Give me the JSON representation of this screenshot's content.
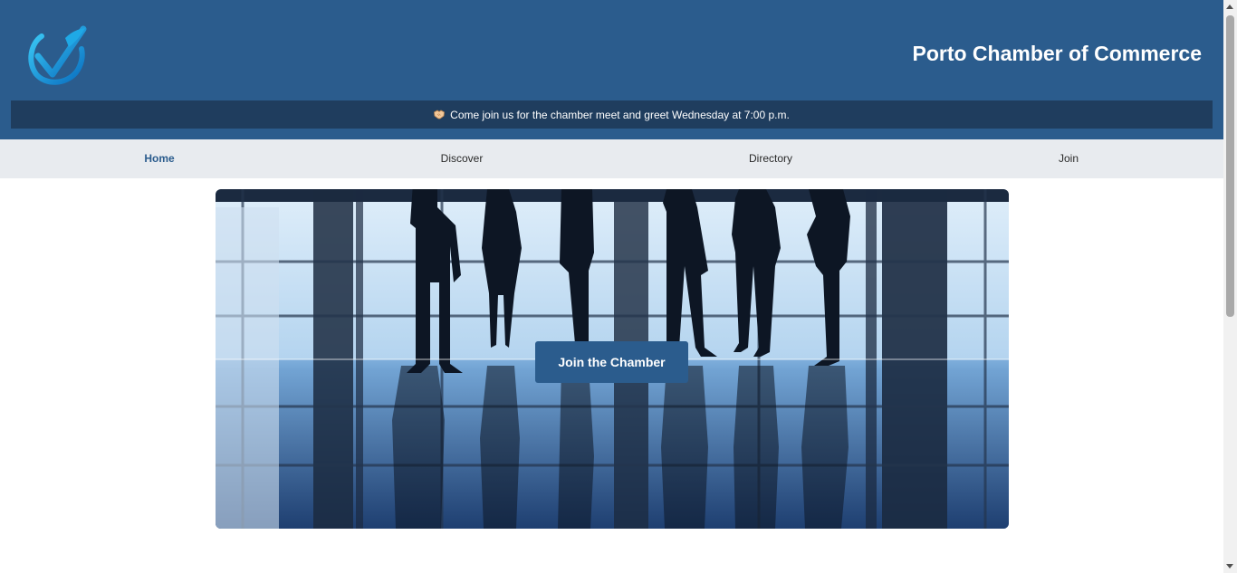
{
  "header": {
    "title": "Porto Chamber of Commerce",
    "logo_icon": "checkmark-logo-icon",
    "banner_icon": "handshake-icon",
    "banner_text": "Come join us for the chamber meet and greet Wednesday at 7:00 p.m."
  },
  "nav": {
    "items": [
      {
        "label": "Home",
        "active": true
      },
      {
        "label": "Discover",
        "active": false
      },
      {
        "label": "Directory",
        "active": false
      },
      {
        "label": "Join",
        "active": false
      }
    ]
  },
  "hero": {
    "image_subject": "business-people-silhouettes-photo",
    "cta_label": "Join the Chamber"
  },
  "colors": {
    "header_bg": "#2b5c8d",
    "banner_bg": "#1f3d5e",
    "nav_bg": "#e8ebef",
    "accent": "#2b5c8d",
    "cta_bg": "#2b5c8d"
  }
}
